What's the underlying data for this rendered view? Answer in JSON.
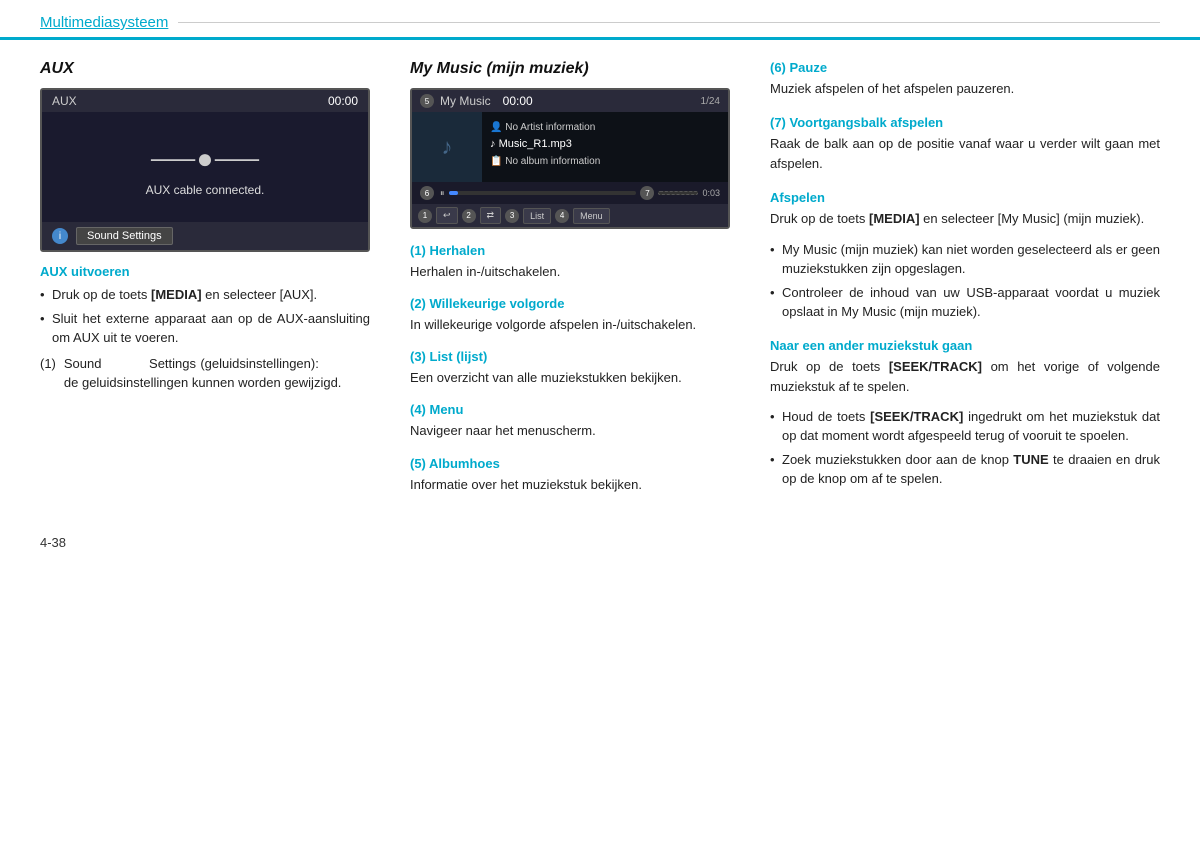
{
  "header": {
    "title": "Multimediasysteem"
  },
  "left_col": {
    "section_title": "AUX",
    "screen": {
      "label": "AUX",
      "time": "00:00",
      "icon": "⸺●⸺",
      "connected_text": "AUX cable connected.",
      "info_label": "i",
      "sound_settings_btn": "Sound Settings"
    },
    "aux_uitvoeren_label": "AUX uitvoeren",
    "bullets": [
      "Druk op de toets [MEDIA] en selecteer [AUX].",
      "Sluit het externe apparaat aan op de AUX-aansluiting om AUX uit te voeren."
    ],
    "numbered_text_num": "(1)",
    "numbered_text_label": "Sound",
    "numbered_text_after": "Settings",
    "numbered_text_rest": "(geluidsinstellingen):                  de geluidsinstellingen kunnen worden gewijzigd."
  },
  "mid_col": {
    "section_title": "My Music (mijn muziek)",
    "screen": {
      "label": "My Music",
      "time": "00:00",
      "count": "1/24",
      "artist": "No Artist information",
      "track": "Music_R1.mp3",
      "album": "No album information",
      "circle6": "6",
      "circle7": "7",
      "time_display": "0:03",
      "circle1": "1",
      "circle2": "2",
      "circle3": "3",
      "btn3_label": "List",
      "circle4": "4",
      "btn4_label": "Menu",
      "circle5": "5"
    },
    "sections": [
      {
        "id": "herhalen",
        "header": "(1) Herhalen",
        "text": "Herhalen in-/uitschakelen."
      },
      {
        "id": "willekeurige",
        "header": "(2) Willekeurige volgorde",
        "text": "In willekeurige volgorde afspelen in-/uitschakelen."
      },
      {
        "id": "list",
        "header": "(3) List (lijst)",
        "text": "Een overzicht van alle muziekstukken bekijken."
      },
      {
        "id": "menu",
        "header": "(4) Menu",
        "text": "Navigeer naar het menuscherm."
      },
      {
        "id": "albumhoes",
        "header": "(5) Albumhoes",
        "text": "Informatie over het muziekstuk bekijken."
      }
    ]
  },
  "right_col": {
    "sections": [
      {
        "id": "pauze",
        "header": "(6) Pauze",
        "text": "Muziek afspelen of het afspelen pauzeren."
      },
      {
        "id": "voortgangsbalk",
        "header": "(7) Voortgangsbalk afspelen",
        "text": "Raak de balk aan op de positie vanaf waar u verder wilt gaan met afspelen."
      },
      {
        "id": "afspelen",
        "header": "Afspelen",
        "text": "Druk op de toets [MEDIA] en selecteer [My Music] (mijn muziek).",
        "bullets": [
          "My Music (mijn muziek) kan niet worden geselecteerd als er geen muziekstukken zijn opgeslagen.",
          "Controleer de inhoud van uw USB-apparaat voordat u muziek opslaat in My Music (mijn muziek)."
        ]
      },
      {
        "id": "ander",
        "header": "Naar een ander muziekstuk gaan",
        "text": "Druk op de toets [SEEK/TRACK] om het vorige of volgende muziekstuk af te spelen.",
        "bullets": [
          "Houd de toets [SEEK/TRACK] ingedrukt om het muziekstuk dat op dat moment wordt afgespeeld terug of vooruit te spoelen.",
          "Zoek muziekstukken door aan de knop TUNE te draaien en druk op de knop om af te spelen."
        ]
      }
    ]
  },
  "footer": {
    "page_number": "4-38"
  }
}
